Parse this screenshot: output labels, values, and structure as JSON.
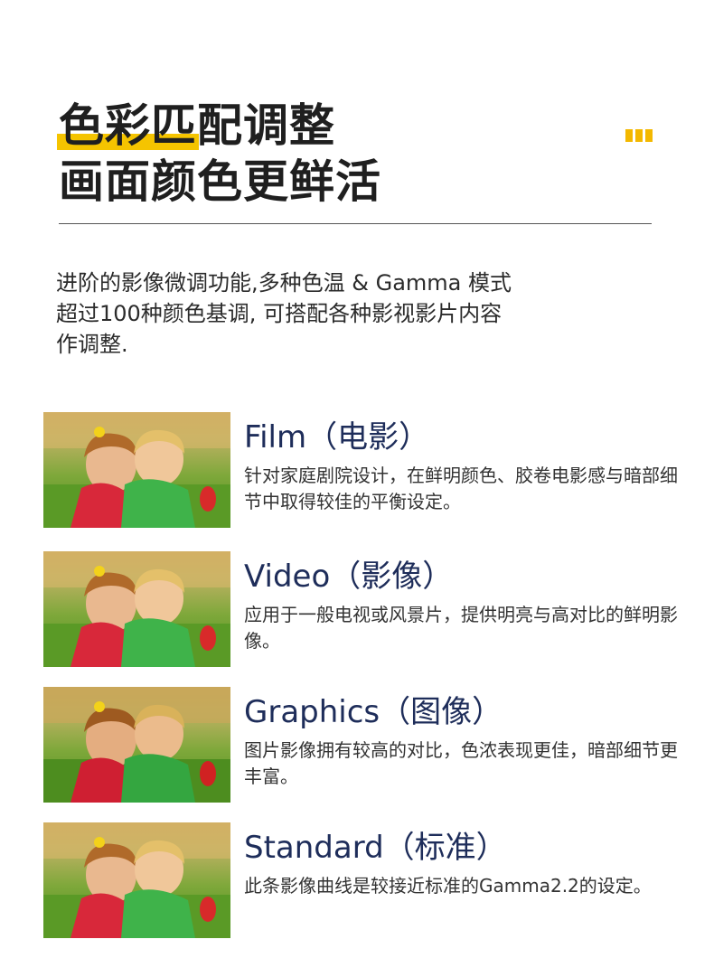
{
  "header": {
    "title_highlight": "色彩匹",
    "title_rest": "配调整",
    "title_line2": "画面颜色更鲜活"
  },
  "intro": {
    "line1": "进阶的影像微调功能,多种色温 & Gamma 模式",
    "line2": "超过100种颜色基调, 可搭配各种影视影片内容",
    "line3": "作调整."
  },
  "modes": [
    {
      "title": "Film（电影）",
      "desc": "针对家庭剧院设计，在鲜明颜色、胶卷电影感与暗部细节中取得较佳的平衡设定。"
    },
    {
      "title": "Video（影像）",
      "desc": "应用于一般电视或风景片，提供明亮与高对比的鲜明影像。"
    },
    {
      "title": "Graphics（图像）",
      "desc": "图片影像拥有较高的对比，色浓表现更佳，暗部细节更丰富。"
    },
    {
      "title": "Standard（标准）",
      "desc": "此条影像曲线是较接近标准的Gamma2.2的设定。"
    }
  ],
  "colors": {
    "accent": "#f5c400",
    "title_blue": "#1e2d5a"
  }
}
